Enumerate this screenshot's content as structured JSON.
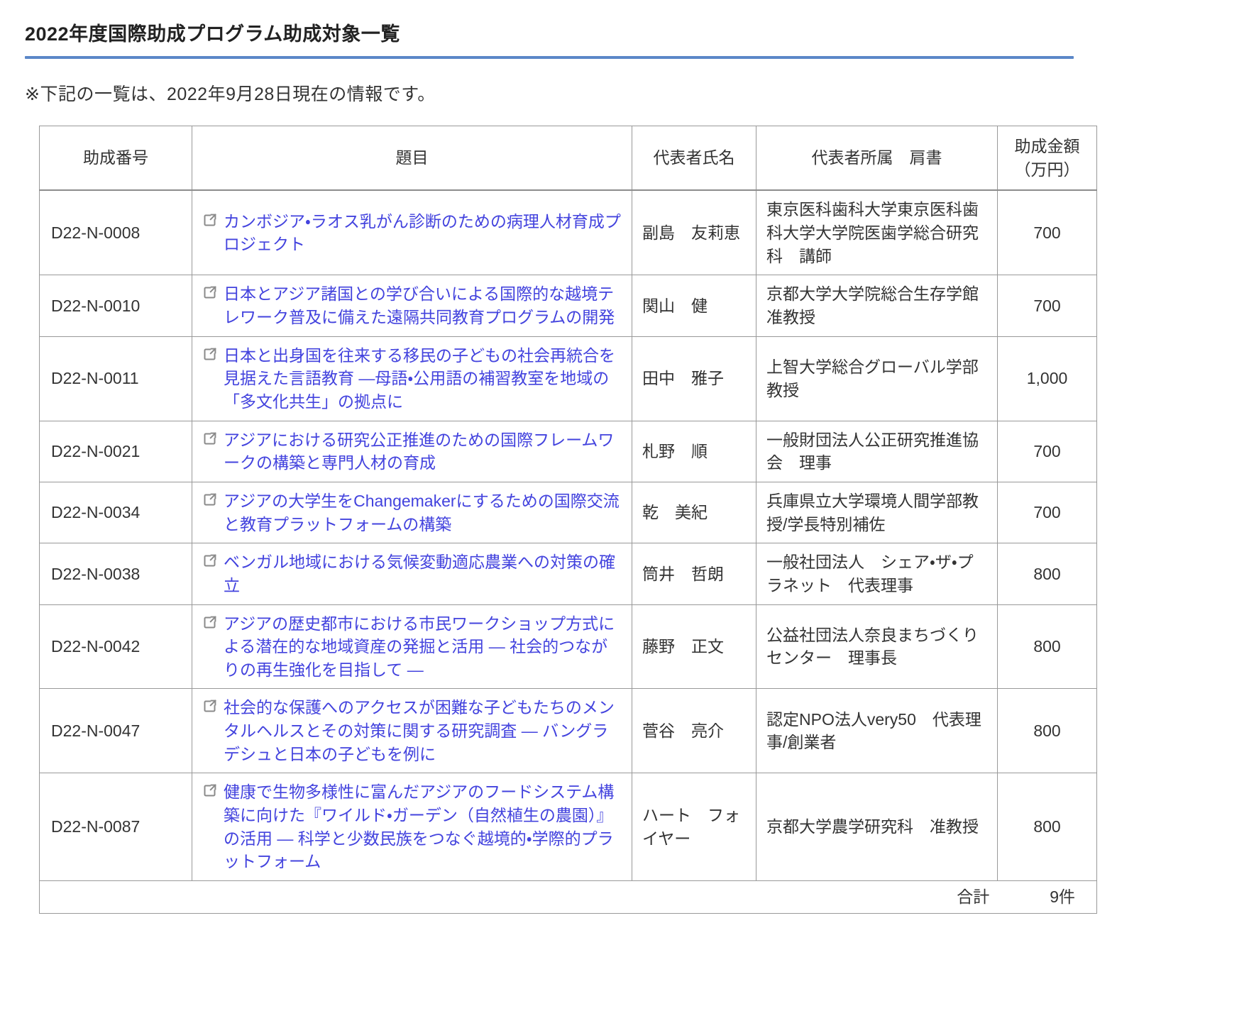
{
  "page": {
    "title": "2022年度国際助成プログラム助成対象一覧",
    "note": "※下記の一覧は、2022年9月28日現在の情報です。"
  },
  "table": {
    "headers": {
      "number": "助成番号",
      "title": "題目",
      "name": "代表者氏名",
      "affiliation": "代表者所属　肩書",
      "amount": "助成金額\n（万円）"
    },
    "rows": [
      {
        "number": "D22-N-0008",
        "title": "カンボジア・ラオス乳がん診断のための病理人材育成プロジェクト",
        "name": "副島　友莉恵",
        "affiliation": "東京医科歯科大学東京医科歯科大学大学院医歯学総合研究科　講師",
        "amount": "700"
      },
      {
        "number": "D22-N-0010",
        "title": "日本とアジア諸国との学び合いによる国際的な越境テレワーク普及に備えた遠隔共同教育プログラムの開発",
        "name": "関山　健",
        "affiliation": "京都大学大学院総合生存学館准教授",
        "amount": "700"
      },
      {
        "number": "D22-N-0011",
        "title": "日本と出身国を往来する移民の子どもの社会再統合を見据えた言語教育 ―母語・公用語の補習教室を地域の「多文化共生」の拠点に",
        "name": "田中　雅子",
        "affiliation": "上智大学総合グローバル学部教授",
        "amount": "1,000"
      },
      {
        "number": "D22-N-0021",
        "title": "アジアにおける研究公正推進のための国際フレームワークの構築と専門人材の育成",
        "name": "札野　順",
        "affiliation": "一般財団法人公正研究推進協会　理事",
        "amount": "700"
      },
      {
        "number": "D22-N-0034",
        "title": "アジアの大学生をChangemakerにするための国際交流と教育プラットフォームの構築",
        "name": "乾　美紀",
        "affiliation": "兵庫県立大学環境人間学部教授/学長特別補佐",
        "amount": "700"
      },
      {
        "number": "D22-N-0038",
        "title": "ベンガル地域における気候変動適応農業への対策の確立",
        "name": "筒井　哲朗",
        "affiliation": "一般社団法人　シェア・ザ・プラネット　代表理事",
        "amount": "800"
      },
      {
        "number": "D22-N-0042",
        "title": "アジアの歴史都市における市民ワークショップ方式による潜在的な地域資産の発掘と活用 ― 社会的つながりの再生強化を目指して ―",
        "name": "藤野　正文",
        "affiliation": "公益社団法人奈良まちづくりセンター　理事長",
        "amount": "800"
      },
      {
        "number": "D22-N-0047",
        "title": "社会的な保護へのアクセスが困難な子どもたちのメンタルヘルスとその対策に関する研究調査 ― バングラデシュと日本の子どもを例に",
        "name": "菅谷　亮介",
        "affiliation": "認定NPO法人very50　代表理事/創業者",
        "amount": "800"
      },
      {
        "number": "D22-N-0087",
        "title": "健康で生物多様性に富んだアジアのフードシステム構築に向けた『ワイルド・ガーデン（自然植生の農園）』の活用 ― 科学と少数民族をつなぐ越境的・学際的プラットフォーム",
        "name": "ハート　フォイヤー",
        "affiliation": "京都大学農学研究科　准教授",
        "amount": "800"
      }
    ],
    "footer": {
      "total_label": "合計",
      "total_count": "9件"
    }
  },
  "colors": {
    "accent_rule": "#5b87c8",
    "link": "#4343de",
    "border": "#999999",
    "text": "#333333",
    "icon": "#8a8a8a"
  }
}
